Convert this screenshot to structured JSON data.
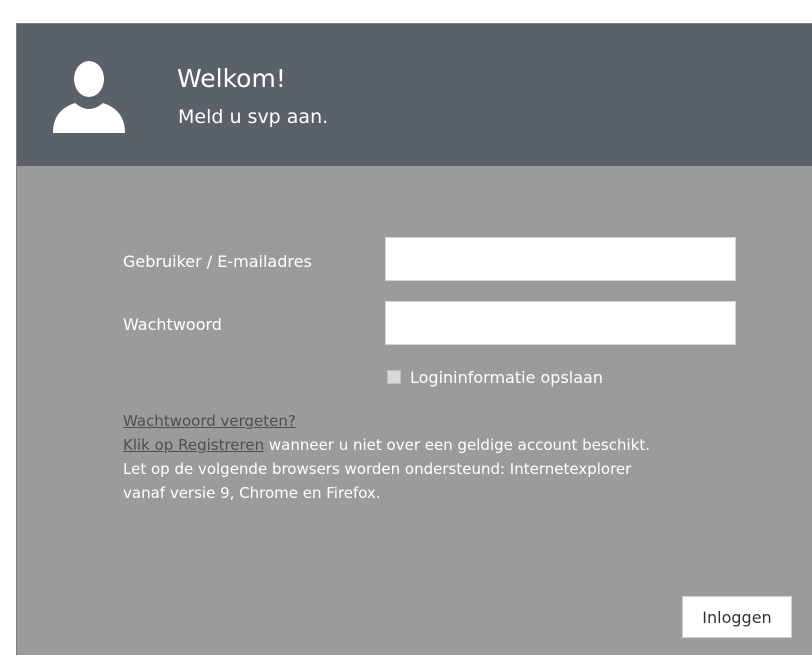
{
  "header": {
    "title": "Welkom!",
    "subtitle": "Meld u svp aan.",
    "avatar_icon": "user-silhouette-icon"
  },
  "form": {
    "username_label": "Gebruiker / E-mailadres",
    "username_value": "",
    "password_label": "Wachtwoord",
    "password_value": "",
    "remember_label": "Logininformatie opslaan",
    "remember_checked": false
  },
  "info": {
    "forgot_link": "Wachtwoord vergeten?",
    "register_link": "Klik op Registreren",
    "register_text": " wanneer u niet over een geldige account beschikt.",
    "browser_note_line1": "Let op de volgende browsers worden ondersteund: Internetexplorer",
    "browser_note_line2": "vanaf versie 9, Chrome en Firefox."
  },
  "actions": {
    "login_label": "Inloggen"
  },
  "colors": {
    "header_bg": "#5b616a",
    "body_bg": "#9b9b9b",
    "link": "#4f4f4f",
    "text": "#ffffff"
  }
}
